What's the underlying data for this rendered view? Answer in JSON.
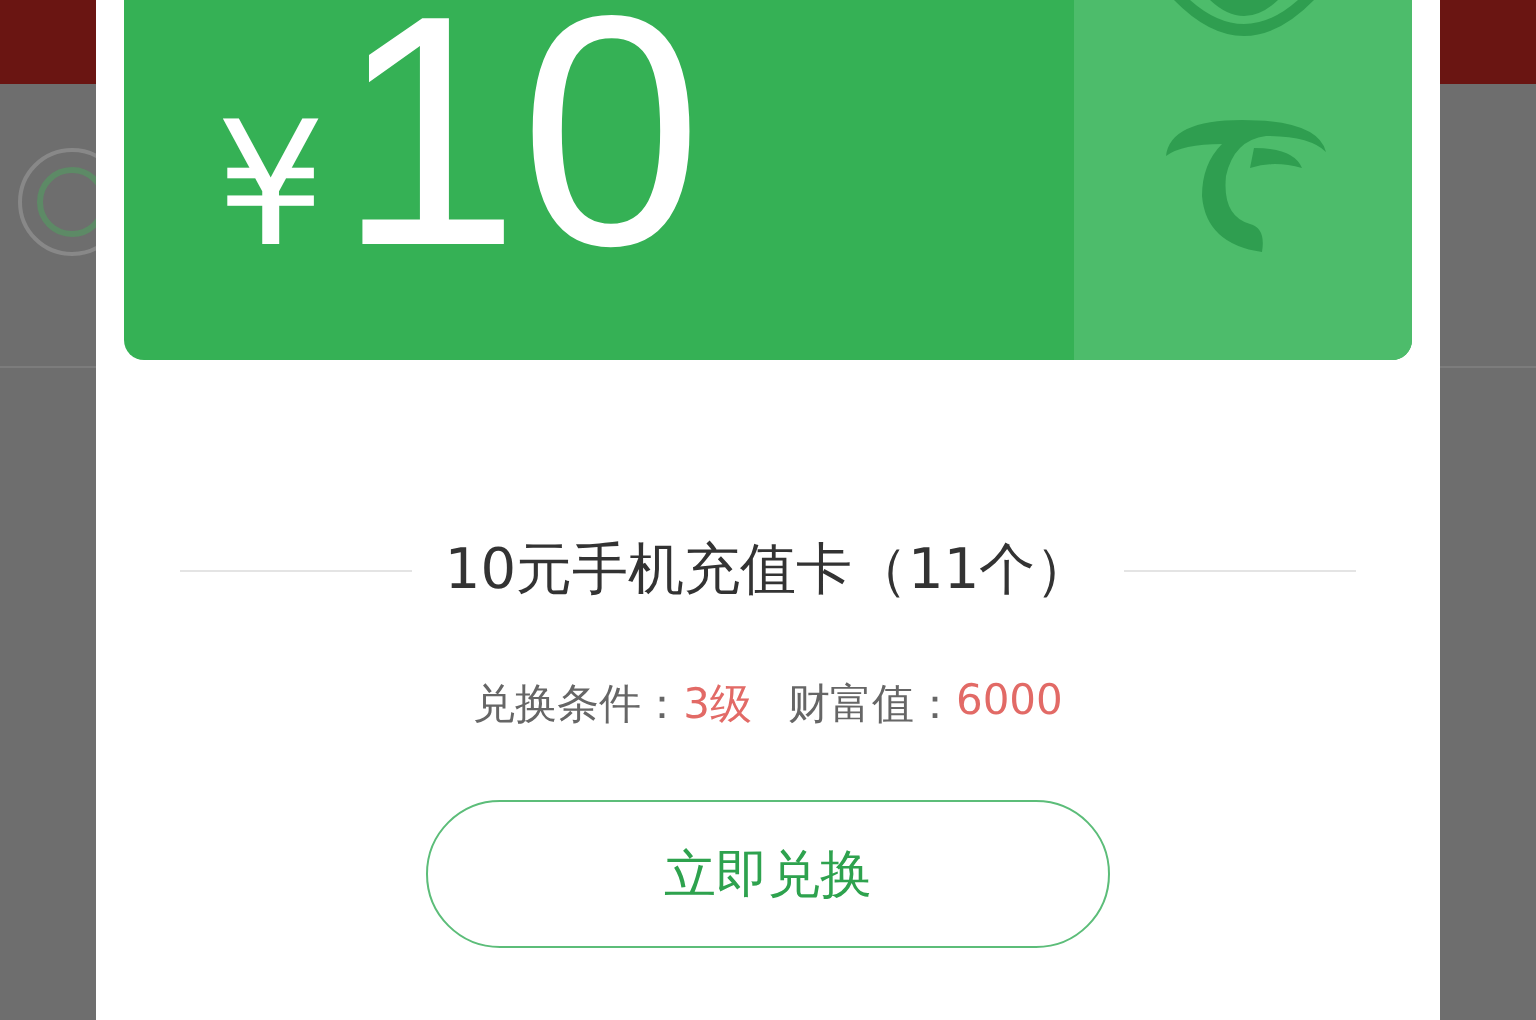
{
  "card": {
    "currency": "¥",
    "amount": "10"
  },
  "title": "10元手机充值卡（11个）",
  "conditions": [
    {
      "label": "兑换条件：",
      "value": "3级"
    },
    {
      "label": "财富值：",
      "value": "6000"
    }
  ],
  "button": "立即兑换"
}
